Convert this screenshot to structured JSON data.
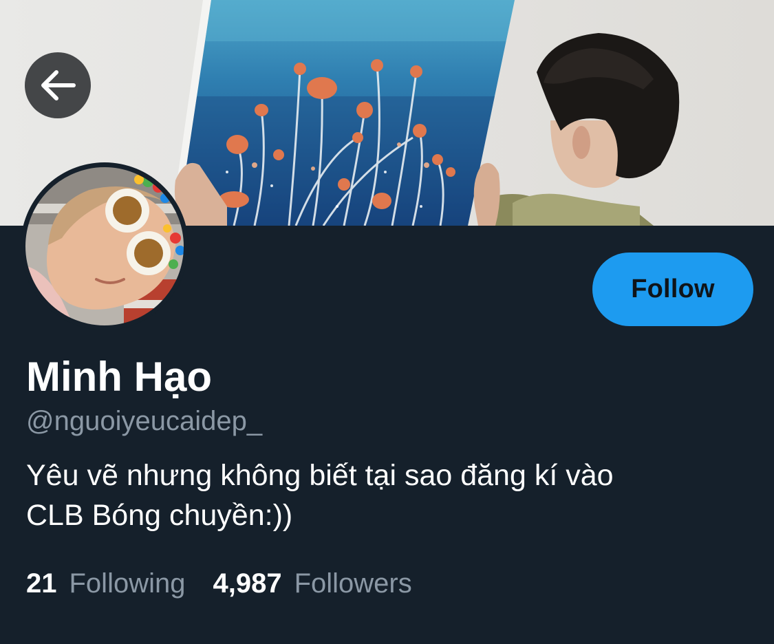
{
  "header": {
    "banner_image": "painting-of-red-flowers-on-blue-background"
  },
  "navigation": {
    "back_icon": "arrow-left-icon"
  },
  "profile": {
    "avatar_image": "person-wearing-novelty-glasses",
    "name": "Minh Hạo",
    "handle": "@nguoiyeucaidep_",
    "bio_line_1": "Yêu vẽ nhưng không biết tại sao đăng kí vào",
    "bio_line_2": "CLB Bóng chuyền:))"
  },
  "follow_button": {
    "label": "Follow"
  },
  "stats": {
    "following_count": "21",
    "following_label": "Following",
    "followers_count": "4,987",
    "followers_label": "Followers"
  },
  "colors": {
    "background": "#15202b",
    "accent": "#1d9bf0",
    "primary_text": "#ffffff",
    "secondary_text": "#8b98a5"
  }
}
